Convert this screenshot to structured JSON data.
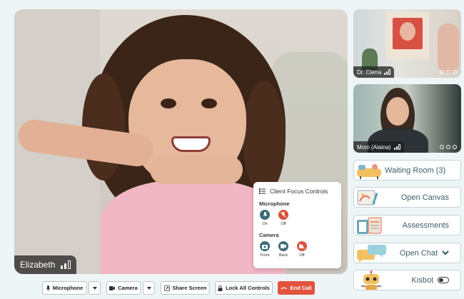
{
  "main_video": {
    "participant_name": "Elizabeth"
  },
  "focus_controls": {
    "title": "Client Focus Controls",
    "microphone": {
      "heading": "Microphone",
      "on_label": "On",
      "off_label": "Off"
    },
    "camera": {
      "heading": "Camera",
      "front_label": "Front",
      "back_label": "Back",
      "off_label": "Off"
    }
  },
  "toolbar": {
    "microphone_label": "Microphone",
    "camera_label": "Camera",
    "share_screen_label": "Share Screen",
    "lock_label": "Lock All Controls",
    "end_call_label": "End Call"
  },
  "participants": [
    {
      "name": "Dr. Cierra"
    },
    {
      "name": "Mom (Alaina)"
    }
  ],
  "features": {
    "waiting_room": "Waiting Room (3)",
    "open_canvas": "Open Canvas",
    "assessments": "Assessments",
    "open_chat": "Open Chat",
    "kisbot": "Kisbot",
    "kisbot_toggle_on": false
  },
  "colors": {
    "accent_teal": "#3d6c78",
    "end_call_red": "#e2543d",
    "muted_red": "#d9533c",
    "background": "#eef5f7"
  }
}
